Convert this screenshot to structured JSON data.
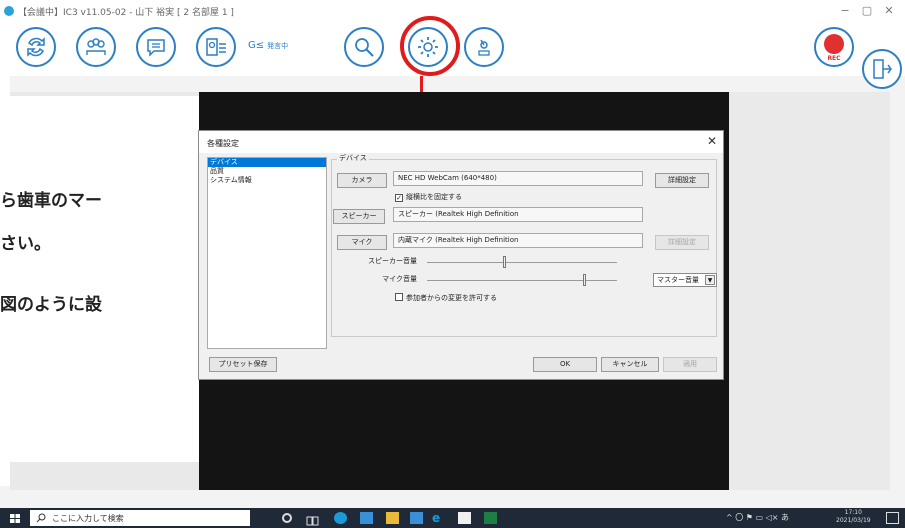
{
  "window": {
    "title": "【会議中】IC3 v11.05-02 - 山下 裕実 [ 2 名部屋 1 ]",
    "minimize": "−",
    "maximize": "▢",
    "close": "✕"
  },
  "toolbar": {
    "speaking_label": "G≤",
    "speaking_sub": "発言中",
    "rec_label": "REC",
    "buttons": [
      {
        "name": "screen-switch",
        "icon": "rotate-arrows-icon"
      },
      {
        "name": "participants",
        "icon": "group-icon"
      },
      {
        "name": "chat",
        "icon": "speech-bubble-icon"
      },
      {
        "name": "member-list",
        "icon": "member-card-icon"
      },
      {
        "name": "search",
        "icon": "magnifier-icon"
      },
      {
        "name": "settings",
        "icon": "gear-icon"
      },
      {
        "name": "remote-camera",
        "icon": "camera-control-icon"
      },
      {
        "name": "exit",
        "icon": "exit-door-icon"
      }
    ]
  },
  "instructions": {
    "line1": "ら歯車のマー",
    "line2": "さい。",
    "line3": "図のように設"
  },
  "dialog": {
    "title": "各種設定",
    "close": "✕",
    "categories": [
      "デバイス",
      "品質",
      "システム情報"
    ],
    "selected_category": "デバイス",
    "group_label": "デバイス",
    "camera_button": "カメラ",
    "camera_value": "NEC HD WebCam (640*480)",
    "detail_button": "詳細設定",
    "aspect_checkbox": "縦横比を固定する",
    "aspect_checked": "✓",
    "speaker_button": "スピーカー",
    "speaker_value": "スピーカー (Realtek High Definition",
    "mic_button": "マイク",
    "mic_value": "内蔵マイク (Realtek High Definition",
    "mic_detail_button": "詳細設定",
    "speaker_volume_label": "スピーカー音量",
    "mic_volume_label": "マイク音量",
    "speaker_volume_level": 0.4,
    "mic_volume_level": 0.82,
    "master_volume_select": "マスター音量",
    "allow_changes_checkbox": "参加者からの変更を許可する",
    "preset_button": "プリセット保存",
    "ok_button": "OK",
    "cancel_button": "キャンセル",
    "apply_button": "適用"
  },
  "taskbar": {
    "search_placeholder": "ここに入力して検索",
    "tray_text": "^ 〇 ⚑ ▭ ◁× あ",
    "time": "17:10",
    "date": "2021/03/19"
  },
  "colors": {
    "accent_blue": "#2b7fc4",
    "annotation_red": "#e01b1b",
    "rec_red": "#e03030",
    "selection_blue": "#0078d7"
  }
}
